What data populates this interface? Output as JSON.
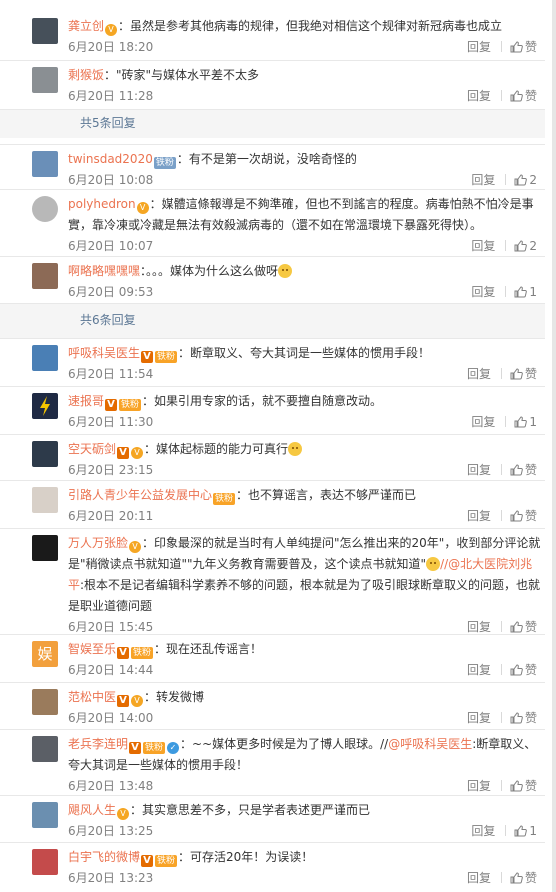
{
  "actions": {
    "reply_label": "回复",
    "zan_label": "赞"
  },
  "comments": [
    {
      "name": "龚立创",
      "badges": [
        "vip"
      ],
      "text": "：虽然是参考其他病毒的规律，但我绝对相信这个规律对新冠病毒也成立",
      "time": "6月20日 18:20",
      "likes": "赞",
      "avatar_color": "#46505a"
    },
    {
      "name": "剩猴饭",
      "badges": [],
      "text": "：\"砖家\"与媒体水平差不太多",
      "time": "6月20日 11:28",
      "likes": "赞",
      "avatar_color": "#8a8f93"
    },
    {
      "more": "共5条回复"
    },
    {
      "name": "twinsdad2020",
      "badges": [
        "iron"
      ],
      "text": "：有不是第一次胡说，没啥奇怪的",
      "time": "6月20日 10:08",
      "likes": "2",
      "avatar_color": "#6a8fb8"
    },
    {
      "name": "polyhedron",
      "badges": [
        "vip"
      ],
      "text": "：媒體這條報導是不夠準確，但也不到謠言的程度。病毒怕熱不怕冷是事實，靠冷凍或冷藏是無法有效殺滅病毒的（還不如在常溫環境下暴露死得快）。",
      "time": "6月20日 10:07",
      "likes": "2",
      "avatar_color": "#b8b8b8"
    },
    {
      "name": "啊略略嘿嘿嘿",
      "badges": [],
      "text": "：。。。媒体为什么这么做呀",
      "emoji": true,
      "time": "6月20日 09:53",
      "likes": "1",
      "avatar_color": "#8c6a56"
    },
    {
      "more": "共6条回复"
    },
    {
      "name": "呼吸科吴医生",
      "badges": [
        "v",
        "fans"
      ],
      "text": "：断章取义、夸大其词是一些媒体的惯用手段！",
      "time": "6月20日 11:54",
      "likes": "赞",
      "avatar_color": "#4a7fb5"
    },
    {
      "name": "速报哥",
      "badges": [
        "v",
        "fans"
      ],
      "text": "：如果引用专家的话，就不要擅自随意改动。",
      "time": "6月20日 11:30",
      "likes": "1",
      "avatar_color": "#1f2a44"
    },
    {
      "name": "空天砺剑",
      "badges": [
        "v",
        "vip"
      ],
      "text": "：媒体起标题的能力可真行",
      "emoji": true,
      "time": "6月20日 23:15",
      "likes": "赞",
      "avatar_color": "#2d3a4a"
    },
    {
      "name": "引路人青少年公益发展中心",
      "badges": [
        "fans"
      ],
      "text": "：也不算谣言，表达不够严谨而已",
      "time": "6月20日 20:11",
      "likes": "赞",
      "avatar_color": "#d8d0c8"
    },
    {
      "name": "万人万张脸",
      "badges": [
        "vip"
      ],
      "text": "：印象最深的就是当时有人单纯提问\"怎么推出来的20年\"，收到部分评论就是\"稍微读点书就知道\"\"九年义务教育需要普及，这个读点书就知道\"",
      "emoji": true,
      "text2": "//@北大医院刘兆平",
      "text3": ":根本不是记者编辑科学素养不够的问题，根本就是为了吸引眼球断章取义的问题，也就是职业道德问题",
      "time": "6月20日 15:45",
      "likes": "赞",
      "avatar_color": "#1a1a1a"
    },
    {
      "name": "智娱至乐",
      "badges": [
        "v",
        "fans"
      ],
      "text": "：现在还乱传谣言！",
      "time": "6月20日 14:44",
      "likes": "赞",
      "avatar_color": "#f2a03d",
      "avatar_text": "娱"
    },
    {
      "name": "范松中医",
      "badges": [
        "v",
        "vip"
      ],
      "text": "：转发微博",
      "time": "6月20日 14:00",
      "likes": "赞",
      "avatar_color": "#9a7b5c"
    },
    {
      "name": "老兵李连明",
      "badges": [
        "v",
        "fans",
        "shield"
      ],
      "text": "：~~媒体更多时候是为了博人眼球。//",
      "text2": "@呼吸科吴医生",
      "text3": ":断章取义、夸大其词是一些媒体的惯用手段！",
      "time": "6月20日 13:48",
      "likes": "赞",
      "avatar_color": "#5b5f66"
    },
    {
      "name": "飓风人生",
      "badges": [
        "vip"
      ],
      "text": "：其实意思差不多，只是学者表述更严谨而已",
      "time": "6月20日 13:25",
      "likes": "1",
      "avatar_color": "#6b8fb0"
    },
    {
      "name": "白宇飞的微博",
      "badges": [
        "v",
        "fans"
      ],
      "text": "：可存活20年！为误读！",
      "time": "6月20日 13:23",
      "likes": "赞",
      "avatar_color": "#c44b4b"
    }
  ]
}
